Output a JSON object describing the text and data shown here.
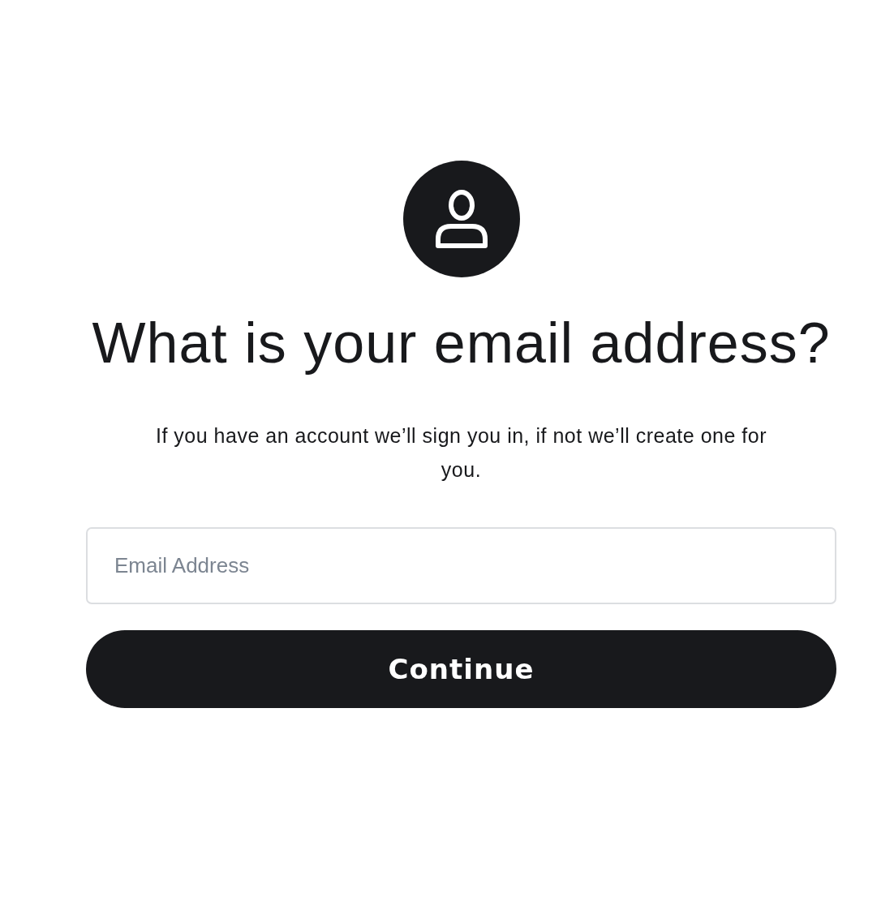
{
  "heading": "What is your email address?",
  "subtitle": "If you have an account we’ll sign you in, if not we’ll create one for you.",
  "email_field": {
    "placeholder": "Email Address"
  },
  "continue_button": {
    "label": "Continue"
  }
}
